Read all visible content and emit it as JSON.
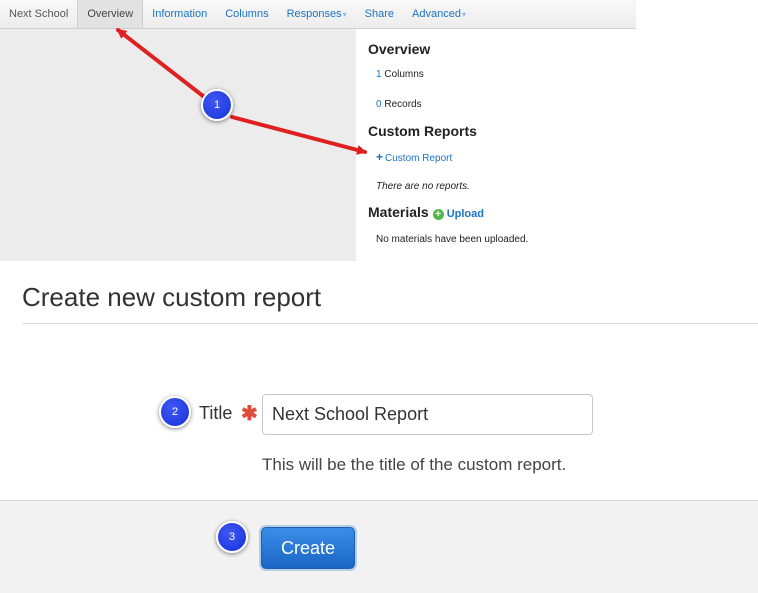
{
  "tabs": [
    {
      "label": "Next School"
    },
    {
      "label": "Overview"
    },
    {
      "label": "Information"
    },
    {
      "label": "Columns"
    },
    {
      "label": "Responses"
    },
    {
      "label": "Share"
    },
    {
      "label": "Advanced"
    }
  ],
  "overview": {
    "heading": "Overview",
    "columns_count": "1",
    "columns_label": "Columns",
    "records_count": "0",
    "records_label": "Records"
  },
  "custom_reports": {
    "heading": "Custom Reports",
    "add_link": "Custom Report",
    "empty_text": "There are no reports."
  },
  "materials": {
    "heading": "Materials",
    "upload_label": "Upload",
    "empty_text": "No materials have been uploaded."
  },
  "form": {
    "title": "Create new custom report",
    "field_label": "Title",
    "field_value": "Next School Report",
    "help_text": "This will be the title of the custom report.",
    "submit_label": "Create"
  },
  "callouts": [
    "1",
    "2",
    "3"
  ],
  "colors": {
    "link": "#1a73c4",
    "callout": "#1632d6",
    "arrow": "#e02020",
    "required": "#e04b3a"
  }
}
